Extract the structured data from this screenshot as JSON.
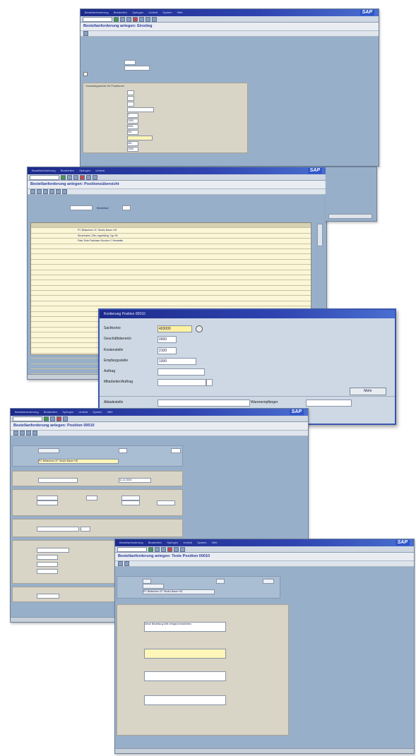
{
  "sap_logo": "SAP",
  "menu_items": [
    "Bestellanforderung",
    "Bearbeiten",
    "Springen",
    "Umfeld",
    "System",
    "Hilfe"
  ],
  "window1": {
    "title": "Bestellanforderung anlegen: Einstieg",
    "group": "Vorschlagswerte für Positionen",
    "fields": {
      "lieferdatum": "T",
      "werk": "1000",
      "lagerort": "0001",
      "warengruppe": "001",
      "einkaufergruppe": "001",
      "einkaufsorg": "1000"
    }
  },
  "window2": {
    "title": "Bestellanforderung anlegen: Positionsübersicht",
    "selection_label": "Bestellart",
    "rows": [
      {
        "text": "PC Bildschirm 21\" Studio Bauer HD"
      },
      {
        "text": "Stromkabel, 20m, lagerfähig, Typ SK"
      },
      {
        "text": "Farb-Tinte Farblaser Drucker C Hersteller"
      }
    ]
  },
  "popup": {
    "title": "Kontierung Position 00010",
    "labels": {
      "sachkonto": "Sachkonto",
      "geschaeftsbereich": "Geschäftsbereich",
      "kostenstelle": "Kostenstelle",
      "empfangsstelle": "Empfangsstelle",
      "auftrag": "Auftrag",
      "mitarbeiter": "Mitarbeiter/Auftrag",
      "abladestelle": "Abladestelle",
      "warenempfaenger": "Warenempfänger"
    },
    "values": {
      "sachkonto": "403000",
      "geschaeftsbereich": "0000",
      "kostenstelle": "2100",
      "empfangsstelle": "1000"
    },
    "more_button": "Mehr"
  },
  "window3": {
    "title": "Bestellanforderung anlegen: Position 00010",
    "material_text": "PC Bildschirm 21\" Studio Bauer HD",
    "date": "11.12.2003"
  },
  "window4": {
    "title": "Bestellanforderung anlegen: Texte Position 00010",
    "material_text": "PC Bildschirm 21\" Studio Bauer HD",
    "text_value": "Diese Bestellung bitte dringend bearbeiten"
  }
}
